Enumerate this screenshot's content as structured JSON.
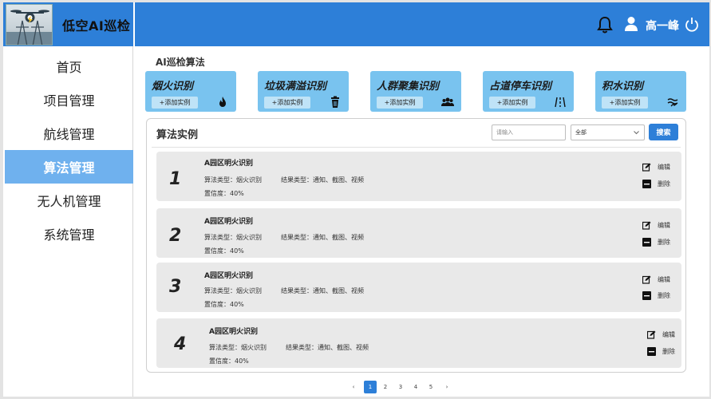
{
  "app": {
    "title": "低空AI巡检"
  },
  "sidebar": {
    "items": [
      {
        "label": "首页",
        "active": false
      },
      {
        "label": "项目管理",
        "active": false
      },
      {
        "label": "航线管理",
        "active": false
      },
      {
        "label": "算法管理",
        "active": true
      },
      {
        "label": "无人机管理",
        "active": false
      },
      {
        "label": "系统管理",
        "active": false
      }
    ]
  },
  "header": {
    "user_name": "高一峰",
    "icons": [
      "bell-icon",
      "user-icon",
      "power-icon"
    ]
  },
  "algorithms": {
    "section_title": "AI巡检算法",
    "cards": [
      {
        "name": "烟火识别",
        "add_label": "+添加实例",
        "icon": "fire-icon"
      },
      {
        "name": "垃圾满溢识别",
        "add_label": "+添加实例",
        "icon": "trash-icon"
      },
      {
        "name": "人群聚集识别",
        "add_label": "+添加实例",
        "icon": "crowd-icon"
      },
      {
        "name": "占道停车识别",
        "add_label": "+添加实例",
        "icon": "road-icon"
      },
      {
        "name": "积水识别",
        "add_label": "+添加实例",
        "icon": "water-icon"
      }
    ]
  },
  "instances": {
    "title": "算法实例",
    "search_placeholder": "请输入",
    "filter_value": "全部",
    "search_label": "搜索",
    "rows": [
      {
        "num": "1",
        "name": "A园区明火识别",
        "algo_type": "算法类型：烟火识别",
        "result_type": "结果类型：通知、截图、视频",
        "confidence": "置信度：40%",
        "edit_label": "编辑",
        "delete_label": "删除"
      },
      {
        "num": "2",
        "name": "A园区明火识别",
        "algo_type": "算法类型：烟火识别",
        "result_type": "结果类型：通知、截图、视频",
        "confidence": "置信度：40%",
        "edit_label": "编辑",
        "delete_label": "删除"
      },
      {
        "num": "3",
        "name": "A园区明火识别",
        "algo_type": "算法类型：烟火识别",
        "result_type": "结果类型：通知、截图、视频",
        "confidence": "置信度：40%",
        "edit_label": "编辑",
        "delete_label": "删除"
      },
      {
        "num": "4",
        "name": "A园区明火识别",
        "algo_type": "算法类型：烟火识别",
        "result_type": "结果类型：通知、截图、视频",
        "confidence": "置信度：40%",
        "edit_label": "编辑",
        "delete_label": "删除"
      }
    ]
  },
  "pagination": {
    "prev": "‹",
    "pages": [
      "1",
      "2",
      "3",
      "4",
      "5"
    ],
    "current": "1",
    "next": "›"
  },
  "colors": {
    "primary": "#2d7fd8",
    "card": "#79c3ef",
    "active_nav": "#6fb1ee"
  }
}
